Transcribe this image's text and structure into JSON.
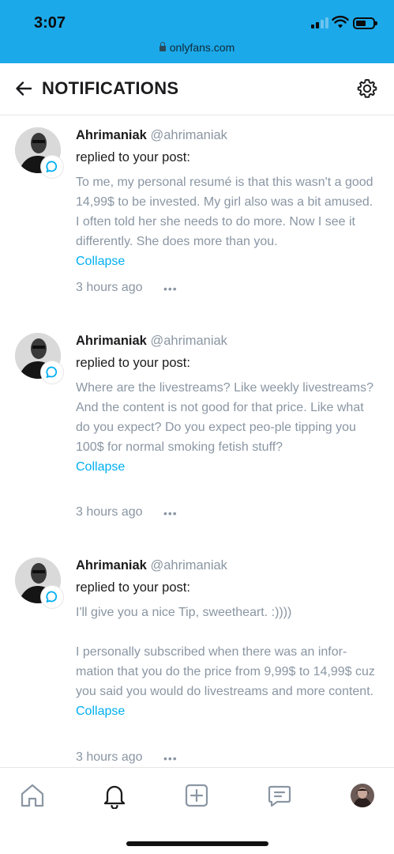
{
  "status_bar": {
    "time": "3:07",
    "url": "onlyfans.com"
  },
  "header": {
    "title": "NOTIFICATIONS",
    "back_icon": "back-arrow-icon",
    "settings_icon": "gear-icon"
  },
  "notifications": [
    {
      "name": "Ahrimaniak",
      "handle": "@ahrimaniak",
      "action": "replied to your post:",
      "paragraphs": [
        "To me, my personal resumé is that this wasn't a good 14,99$ to be invested. My girl also was a bit amused. I often told her she needs to do more. Now I see it differently. She does more than you."
      ],
      "collapse": "Collapse",
      "time": "3 hours ago",
      "more": "•••"
    },
    {
      "name": "Ahrimaniak",
      "handle": "@ahrimaniak",
      "action": "replied to your post:",
      "paragraphs": [
        "Where are the livestreams? Like weekly livestreams? And the content is not good for that price. Like what do you expect? Do you expect peo-ple tipping you 100$ for normal smoking fetish stuff?"
      ],
      "collapse": "Collapse",
      "time": "3 hours ago",
      "more": "•••"
    },
    {
      "name": "Ahrimaniak",
      "handle": "@ahrimaniak",
      "action": "replied to your post:",
      "paragraphs": [
        "I'll give you a nice Tip, sweetheart. :))))",
        "I personally subscribed when there was an infor-mation that you do the price from 9,99$ to 14,99$ cuz you said you would do livestreams and more content."
      ],
      "collapse": "Collapse",
      "time": "3 hours ago",
      "more": "•••"
    }
  ],
  "tab_bar": {
    "items": [
      "home-icon",
      "bell-icon",
      "plus-square-icon",
      "message-icon",
      "profile-avatar"
    ],
    "active": "bell-icon"
  },
  "colors": {
    "status_bar": "#1ca9e9",
    "accent": "#00aff0",
    "muted_text": "#8a96a3",
    "primary_text": "#1c1c1e"
  }
}
